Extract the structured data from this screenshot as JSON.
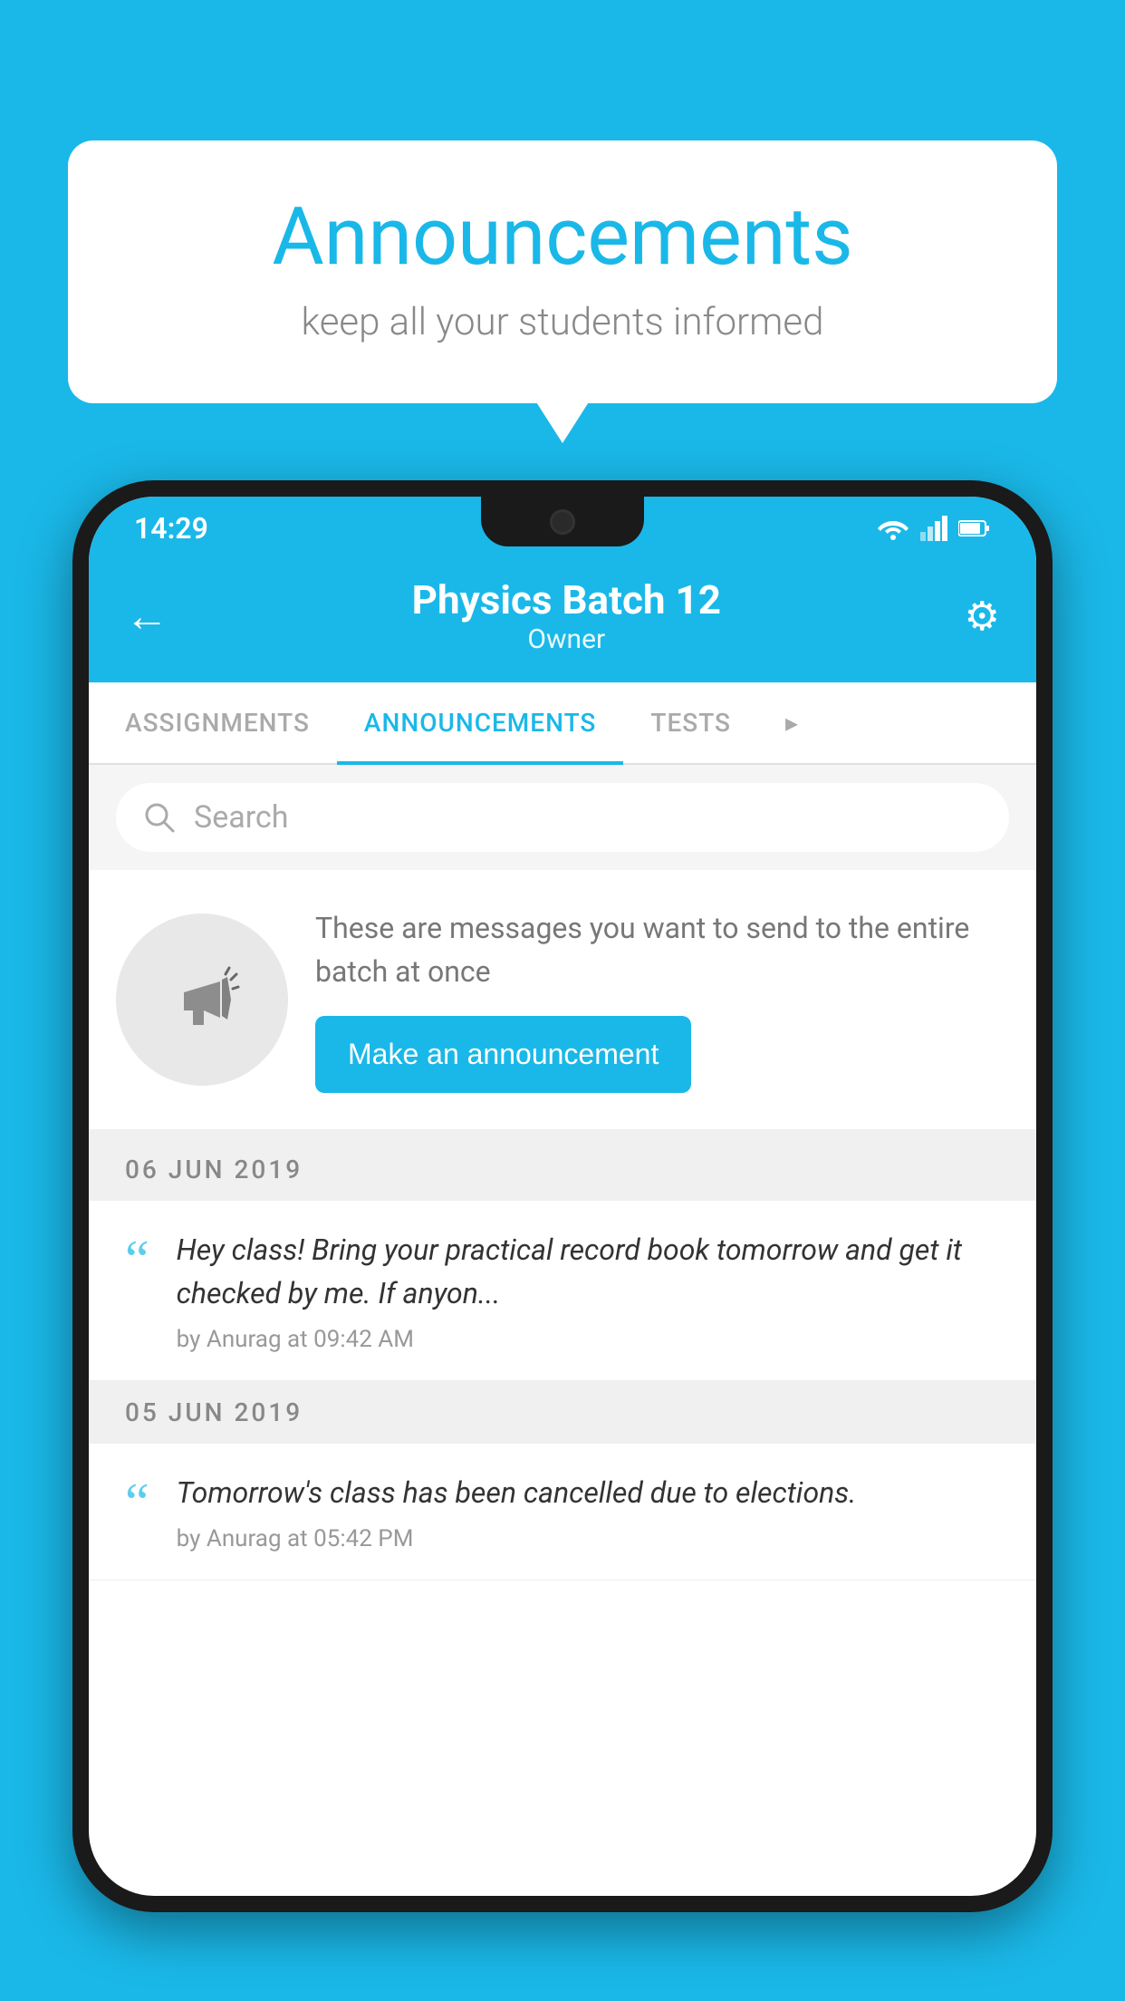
{
  "background_color": "#1ab8e8",
  "speech_bubble": {
    "title": "Announcements",
    "subtitle": "keep all your students informed"
  },
  "status_bar": {
    "time": "14:29"
  },
  "app_header": {
    "back_label": "←",
    "title": "Physics Batch 12",
    "subtitle": "Owner",
    "gear_icon": "⚙"
  },
  "tabs": [
    {
      "label": "ASSIGNMENTS",
      "active": false
    },
    {
      "label": "ANNOUNCEMENTS",
      "active": true
    },
    {
      "label": "TESTS",
      "active": false
    },
    {
      "label": "...",
      "active": false
    }
  ],
  "search": {
    "placeholder": "Search"
  },
  "promo": {
    "description": "These are messages you want to send to the entire batch at once",
    "button_label": "Make an announcement"
  },
  "announcement_sections": [
    {
      "date": "06  JUN  2019",
      "items": [
        {
          "text": "Hey class! Bring your practical record book tomorrow and get it checked by me. If anyon...",
          "meta": "by Anurag at 09:42 AM"
        }
      ]
    },
    {
      "date": "05  JUN  2019",
      "items": [
        {
          "text": "Tomorrow's class has been cancelled due to elections.",
          "meta": "by Anurag at 05:42 PM"
        }
      ]
    }
  ]
}
